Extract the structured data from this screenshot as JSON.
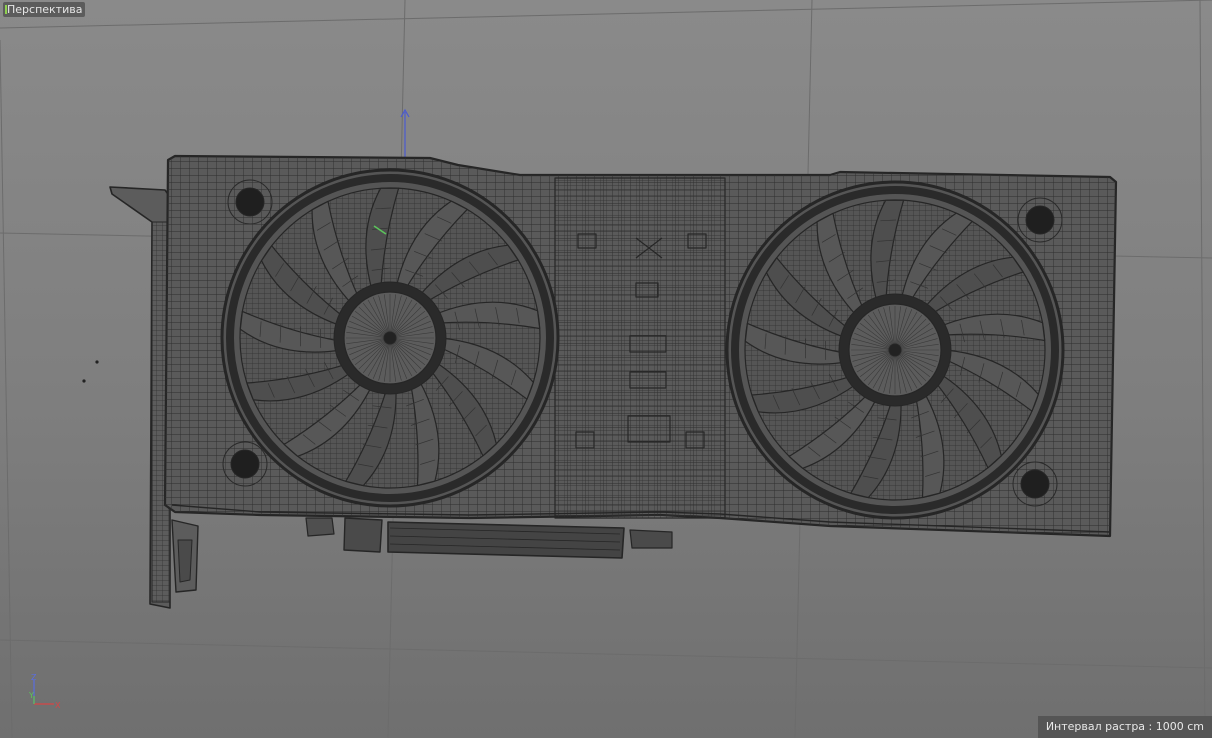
{
  "viewport": {
    "view_name": "Перспектива",
    "status_text": "Интервал растра : 1000 cm"
  },
  "axis_gizmo": {
    "labels": {
      "z": "Z",
      "y": "Y",
      "x": "X"
    },
    "colors": {
      "x": "#d64545",
      "y": "#5cc45c",
      "z": "#5a6ee0"
    }
  },
  "model": {
    "name": "graphics card wireframe",
    "wire_color": "#2b2b2b",
    "fill_color": "#5a5a5a",
    "fan_count": 2,
    "fan_blade_count": 13
  },
  "colors": {
    "grid_line": "#6a6a6a",
    "background_top": "#8a8a8a",
    "background_bottom": "#6f6f6f"
  }
}
